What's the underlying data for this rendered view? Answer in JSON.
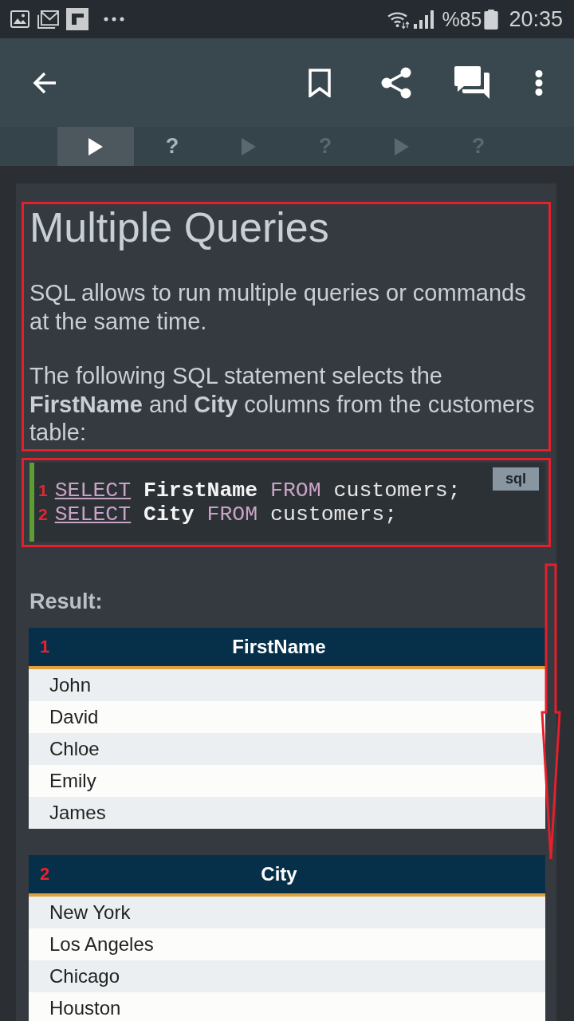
{
  "status_bar": {
    "battery": "%85",
    "time": "20:35"
  },
  "tabs": [
    {
      "kind": "lesson",
      "selected": true,
      "locked": false
    },
    {
      "kind": "quiz",
      "label": "?",
      "selected": false,
      "locked": false
    },
    {
      "kind": "lesson",
      "selected": false,
      "locked": true
    },
    {
      "kind": "quiz",
      "label": "?",
      "selected": false,
      "locked": true
    },
    {
      "kind": "lesson",
      "selected": false,
      "locked": true
    },
    {
      "kind": "quiz",
      "label": "?",
      "selected": false,
      "locked": true
    }
  ],
  "lesson": {
    "highlighted": true,
    "title": "Multiple Queries",
    "paragraphs": [
      "SQL allows to run multiple queries or commands at the same time.",
      "The following SQL statement selects the **FirstName** and **City** columns from the customers table:"
    ]
  },
  "code": {
    "highlighted": true,
    "language": "sql",
    "lines": [
      {
        "number": "1",
        "tokens": [
          {
            "kind": "keyword",
            "text": "SELECT",
            "linked": true
          },
          {
            "kind": "column",
            "text": "FirstName",
            "linked": false
          },
          {
            "kind": "keyword",
            "text": "FROM",
            "linked": false
          },
          {
            "kind": "plain",
            "text": "customers;",
            "linked": false
          }
        ]
      },
      {
        "number": "2",
        "tokens": [
          {
            "kind": "keyword",
            "text": "SELECT",
            "linked": true
          },
          {
            "kind": "column",
            "text": "City",
            "linked": false
          },
          {
            "kind": "keyword",
            "text": "FROM",
            "linked": false
          },
          {
            "kind": "plain",
            "text": "customers;",
            "linked": false
          }
        ]
      }
    ]
  },
  "result": {
    "label": "Result:",
    "tables": [
      {
        "number": "1",
        "column": "FirstName",
        "rows": [
          "John",
          "David",
          "Chloe",
          "Emily",
          "James"
        ]
      },
      {
        "number": "2",
        "column": "City",
        "rows": [
          "New York",
          "Los Angeles",
          "Chicago",
          "Houston"
        ]
      }
    ]
  },
  "annotations": [
    {
      "kind": "down-arrow"
    }
  ]
}
